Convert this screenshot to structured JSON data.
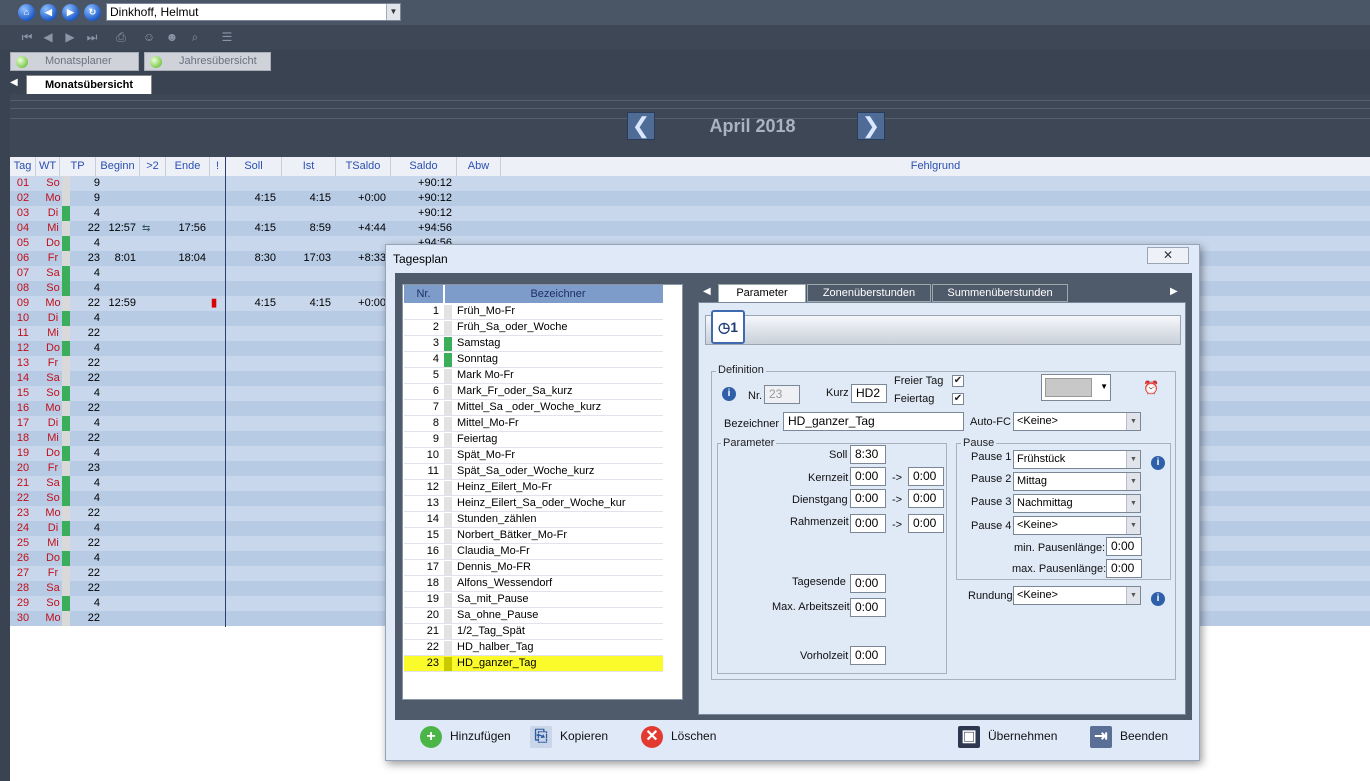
{
  "topbar": {
    "person": "Dinkhoff, Helmut"
  },
  "tabs": {
    "monatsplaner": "Monatsplaner",
    "jahresuebersicht": "Jahresübersicht",
    "monatsuebersicht": "Monatsübersicht"
  },
  "month": {
    "title": "April 2018",
    "prev": "❮",
    "next": "❯"
  },
  "grid": {
    "headers": {
      "tag": "Tag",
      "wt": "WT",
      "tp": "TP",
      "beginn": "Beginn",
      "gt2": ">2",
      "ende": "Ende",
      "excl": "!",
      "soll": "Soll",
      "ist": "Ist",
      "tsaldo": "TSaldo",
      "saldo": "Saldo",
      "abw": "Abw",
      "fehlgrund": "Fehlgrund"
    },
    "rows": [
      {
        "tag": "01",
        "wt": "So",
        "tp": "9",
        "beginn": "",
        "ende": "",
        "soll": "",
        "ist": "",
        "tsaldo": "",
        "saldo": "+90:12",
        "color": "#d9d9d9"
      },
      {
        "tag": "02",
        "wt": "Mo",
        "tp": "9",
        "beginn": "",
        "ende": "",
        "soll": "4:15",
        "ist": "4:15",
        "tsaldo": "+0:00",
        "saldo": "+90:12",
        "color": "#d9d9d9"
      },
      {
        "tag": "03",
        "wt": "Di",
        "tp": "4",
        "beginn": "",
        "ende": "",
        "soll": "",
        "ist": "",
        "tsaldo": "",
        "saldo": "+90:12",
        "color": "#3aae5a"
      },
      {
        "tag": "04",
        "wt": "Mi",
        "tp": "22",
        "beginn": "12:57",
        "icon": "⇆",
        "ende": "17:56",
        "soll": "4:15",
        "ist": "8:59",
        "tsaldo": "+4:44",
        "saldo": "+94:56",
        "color": "#d9d9d9"
      },
      {
        "tag": "05",
        "wt": "Do",
        "tp": "4",
        "beginn": "",
        "ende": "",
        "soll": "",
        "ist": "",
        "tsaldo": "",
        "saldo": "+94:56",
        "color": "#3aae5a"
      },
      {
        "tag": "06",
        "wt": "Fr",
        "tp": "23",
        "beginn": "8:01",
        "ende": "18:04",
        "soll": "8:30",
        "ist": "17:03",
        "tsaldo": "+8:33",
        "saldo": "",
        "color": "#d9d9d9"
      },
      {
        "tag": "07",
        "wt": "Sa",
        "tp": "4",
        "beginn": "",
        "ende": "",
        "soll": "",
        "ist": "",
        "tsaldo": "",
        "saldo": "",
        "color": "#3aae5a"
      },
      {
        "tag": "08",
        "wt": "So",
        "tp": "4",
        "beginn": "",
        "ende": "",
        "soll": "",
        "ist": "",
        "tsaldo": "",
        "saldo": "",
        "color": "#3aae5a"
      },
      {
        "tag": "09",
        "wt": "Mo",
        "tp": "22",
        "beginn": "12:59",
        "mark": "▮",
        "ende": "",
        "soll": "4:15",
        "ist": "4:15",
        "tsaldo": "+0:00",
        "saldo": "",
        "color": "#d9d9d9"
      },
      {
        "tag": "10",
        "wt": "Di",
        "tp": "4",
        "color": "#3aae5a"
      },
      {
        "tag": "11",
        "wt": "Mi",
        "tp": "22",
        "color": "#d9d9d9"
      },
      {
        "tag": "12",
        "wt": "Do",
        "tp": "4",
        "color": "#3aae5a"
      },
      {
        "tag": "13",
        "wt": "Fr",
        "tp": "22",
        "color": "#d9d9d9"
      },
      {
        "tag": "14",
        "wt": "Sa",
        "tp": "22",
        "color": "#d9d9d9"
      },
      {
        "tag": "15",
        "wt": "So",
        "tp": "4",
        "color": "#3aae5a"
      },
      {
        "tag": "16",
        "wt": "Mo",
        "tp": "22",
        "color": "#d9d9d9"
      },
      {
        "tag": "17",
        "wt": "Di",
        "tp": "4",
        "color": "#3aae5a"
      },
      {
        "tag": "18",
        "wt": "Mi",
        "tp": "22",
        "color": "#d9d9d9"
      },
      {
        "tag": "19",
        "wt": "Do",
        "tp": "4",
        "color": "#3aae5a"
      },
      {
        "tag": "20",
        "wt": "Fr",
        "tp": "23",
        "color": "#d9d9d9"
      },
      {
        "tag": "21",
        "wt": "Sa",
        "tp": "4",
        "color": "#3aae5a"
      },
      {
        "tag": "22",
        "wt": "So",
        "tp": "4",
        "color": "#3aae5a"
      },
      {
        "tag": "23",
        "wt": "Mo",
        "tp": "22",
        "color": "#d9d9d9"
      },
      {
        "tag": "24",
        "wt": "Di",
        "tp": "4",
        "color": "#3aae5a"
      },
      {
        "tag": "25",
        "wt": "Mi",
        "tp": "22",
        "color": "#d9d9d9"
      },
      {
        "tag": "26",
        "wt": "Do",
        "tp": "4",
        "color": "#3aae5a"
      },
      {
        "tag": "27",
        "wt": "Fr",
        "tp": "22",
        "color": "#d9d9d9"
      },
      {
        "tag": "28",
        "wt": "Sa",
        "tp": "22",
        "color": "#d9d9d9"
      },
      {
        "tag": "29",
        "wt": "So",
        "tp": "4",
        "color": "#3aae5a"
      },
      {
        "tag": "30",
        "wt": "Mo",
        "tp": "22",
        "color": "#d9d9d9"
      }
    ]
  },
  "dialog": {
    "title": "Tagesplan",
    "close": "✕",
    "list": {
      "head_nr": "Nr.",
      "head_bez": "Bezeichner",
      "items": [
        {
          "nr": "1",
          "bez": "Früh_Mo-Fr",
          "color": "#e2e2e2"
        },
        {
          "nr": "2",
          "bez": "Früh_Sa_oder_Woche",
          "color": "#e2e2e2"
        },
        {
          "nr": "3",
          "bez": "Samstag",
          "color": "#3aae5a"
        },
        {
          "nr": "4",
          "bez": "Sonntag",
          "color": "#3aae5a"
        },
        {
          "nr": "5",
          "bez": "Mark Mo-Fr",
          "color": "#e2e2e2"
        },
        {
          "nr": "6",
          "bez": "Mark_Fr_oder_Sa_kurz",
          "color": "#e2e2e2"
        },
        {
          "nr": "7",
          "bez": "Mittel_Sa _oder_Woche_kurz",
          "color": "#e2e2e2"
        },
        {
          "nr": "8",
          "bez": "Mittel_Mo-Fr",
          "color": "#e2e2e2"
        },
        {
          "nr": "9",
          "bez": "Feiertag",
          "color": "#e2e2e2"
        },
        {
          "nr": "10",
          "bez": "Spät_Mo-Fr",
          "color": "#e2e2e2"
        },
        {
          "nr": "11",
          "bez": "Spät_Sa_oder_Woche_kurz",
          "color": "#e2e2e2"
        },
        {
          "nr": "12",
          "bez": "Heinz_Eilert_Mo-Fr",
          "color": "#e2e2e2"
        },
        {
          "nr": "13",
          "bez": "Heinz_Eilert_Sa_oder_Woche_kur",
          "color": "#e2e2e2"
        },
        {
          "nr": "14",
          "bez": "Stunden_zählen",
          "color": "#e2e2e2"
        },
        {
          "nr": "15",
          "bez": "Norbert_Bätker_Mo-Fr",
          "color": "#e2e2e2"
        },
        {
          "nr": "16",
          "bez": "Claudia_Mo-Fr",
          "color": "#e2e2e2"
        },
        {
          "nr": "17",
          "bez": "Dennis_Mo-FR",
          "color": "#e2e2e2"
        },
        {
          "nr": "18",
          "bez": "Alfons_Wessendorf",
          "color": "#e2e2e2"
        },
        {
          "nr": "19",
          "bez": "Sa_mit_Pause",
          "color": "#e2e2e2"
        },
        {
          "nr": "20",
          "bez": "Sa_ohne_Pause",
          "color": "#e2e2e2"
        },
        {
          "nr": "21",
          "bez": "1/2_Tag_Spät",
          "color": "#e2e2e2"
        },
        {
          "nr": "22",
          "bez": "HD_halber_Tag",
          "color": "#e2e2e2"
        },
        {
          "nr": "23",
          "bez": "HD_ganzer_Tag",
          "color": "#c9c900"
        }
      ]
    },
    "tabs": {
      "parameter": "Parameter",
      "zonen": "Zonenüberstunden",
      "summen": "Summenüberstunden"
    },
    "definition": {
      "group": "Definition",
      "nr_label": "Nr.",
      "nr_value": "23",
      "kurz_label": "Kurz",
      "kurz_value": "HD2",
      "freier_tag_label": "Freier Tag",
      "freier_tag_check": "✔",
      "feiertag_label": "Feiertag",
      "feiertag_check": "✔",
      "bez_label": "Bezeichner",
      "bez_value": "HD_ganzer_Tag",
      "autofc_label": "Auto-FC",
      "autofc_value": "<Keine>"
    },
    "parameter": {
      "group": "Parameter",
      "soll_label": "Soll",
      "soll_value": "8:30",
      "kern_label": "Kernzeit",
      "kern_from": "0:00",
      "kern_to": "0:00",
      "dienst_label": "Dienstgang",
      "dienst_from": "0:00",
      "dienst_to": "0:00",
      "rahmen_label": "Rahmenzeit",
      "rahmen_from": "0:00",
      "rahmen_to": "0:00",
      "arrow": "->",
      "tagesende_label": "Tagesende",
      "tagesende_value": "0:00",
      "maxarb_label": "Max. Arbeitszeit",
      "maxarb_value": "0:00",
      "vorhol_label": "Vorholzeit",
      "vorhol_value": "0:00"
    },
    "pause": {
      "group": "Pause",
      "p1_label": "Pause 1",
      "p1_value": "Frühstück",
      "p2_label": "Pause 2",
      "p2_value": "Mittag",
      "p3_label": "Pause 3",
      "p3_value": "Nachmittag",
      "p4_label": "Pause 4",
      "p4_value": "<Keine>",
      "min_label": "min. Pausenlänge:",
      "min_value": "0:00",
      "max_label": "max. Pausenlänge:",
      "max_value": "0:00"
    },
    "rundung": {
      "label": "Rundung",
      "value": "<Keine>"
    },
    "buttons": {
      "add": "Hinzufügen",
      "copy": "Kopieren",
      "delete": "Löschen",
      "apply": "Übernehmen",
      "exit": "Beenden"
    }
  }
}
